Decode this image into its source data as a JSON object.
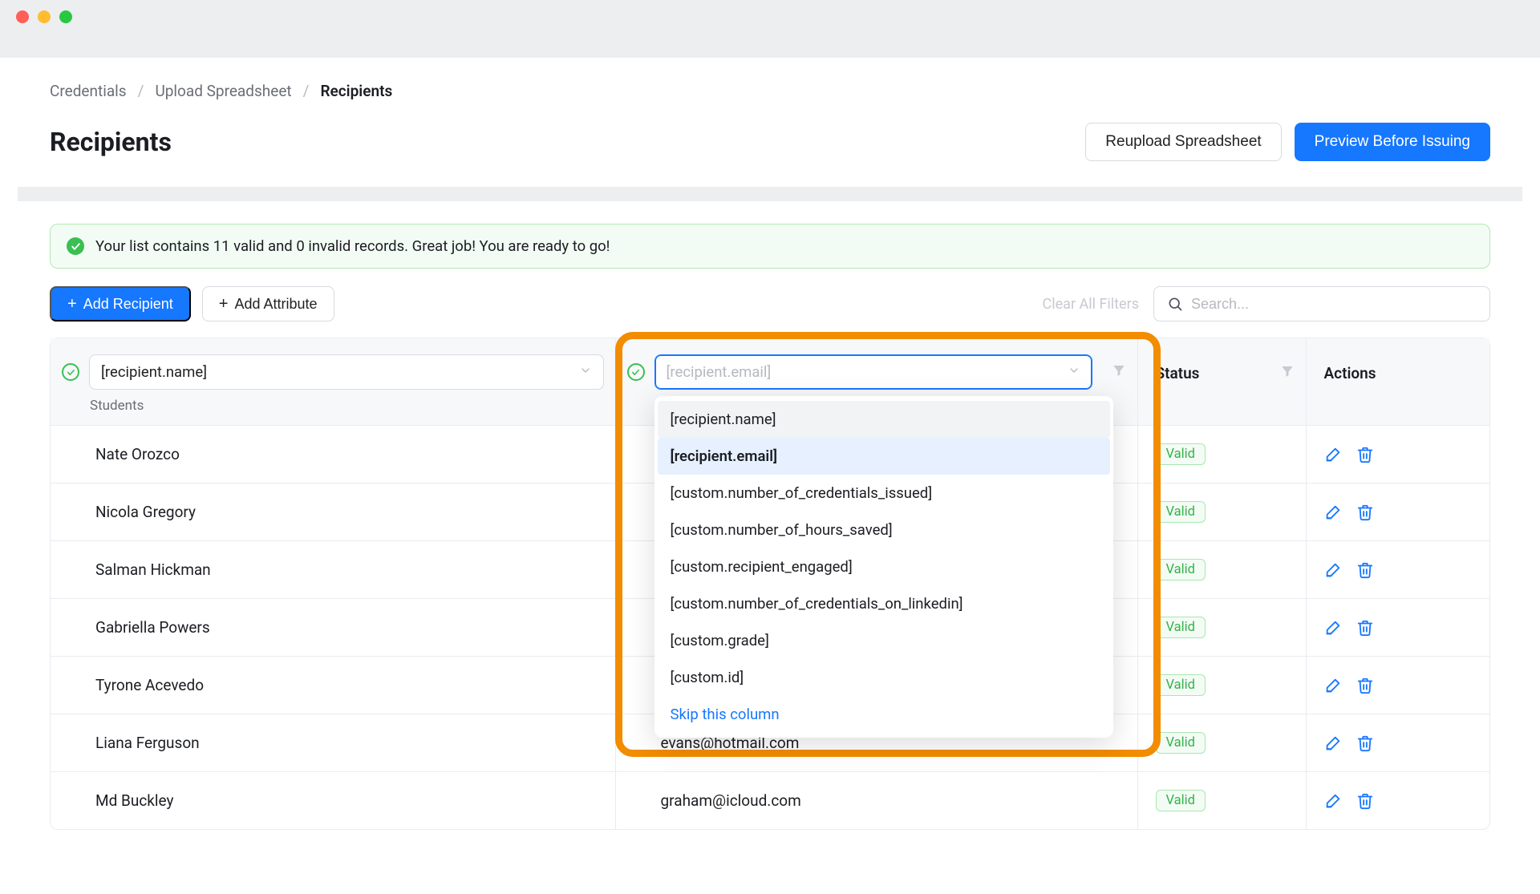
{
  "breadcrumbs": {
    "items": [
      "Credentials",
      "Upload Spreadsheet",
      "Recipients"
    ]
  },
  "page_title": "Recipients",
  "header_buttons": {
    "reupload": "Reupload Spreadsheet",
    "preview": "Preview Before Issuing"
  },
  "alert": {
    "text": "Your list contains 11 valid and 0 invalid records. Great job! You are ready to go!"
  },
  "toolbar": {
    "add_recipient": "Add Recipient",
    "add_attribute": "Add Attribute",
    "clear_filters": "Clear All Filters",
    "search_placeholder": "Search..."
  },
  "table": {
    "header": {
      "name_select_value": "[recipient.name]",
      "name_sub": "Students",
      "email_select_placeholder": "[recipient.email]",
      "status": "Status",
      "actions": "Actions"
    },
    "status_label": "Valid",
    "rows": [
      {
        "name": "Nate Orozco",
        "email": ""
      },
      {
        "name": "Nicola Gregory",
        "email": ""
      },
      {
        "name": "Salman Hickman",
        "email": ""
      },
      {
        "name": "Gabriella Powers",
        "email": ""
      },
      {
        "name": "Tyrone Acevedo",
        "email": ""
      },
      {
        "name": "Liana Ferguson",
        "email": "evans@hotmail.com"
      },
      {
        "name": "Md Buckley",
        "email": "graham@icloud.com"
      }
    ]
  },
  "dropdown": {
    "options": [
      "[recipient.name]",
      "[recipient.email]",
      "[custom.number_of_credentials_issued]",
      "[custom.number_of_hours_saved]",
      "[custom.recipient_engaged]",
      "[custom.number_of_credentials_on_linkedin]",
      "[custom.grade]",
      "[custom.id]"
    ],
    "skip": "Skip this column",
    "hover_index": 0,
    "selected_index": 1
  }
}
